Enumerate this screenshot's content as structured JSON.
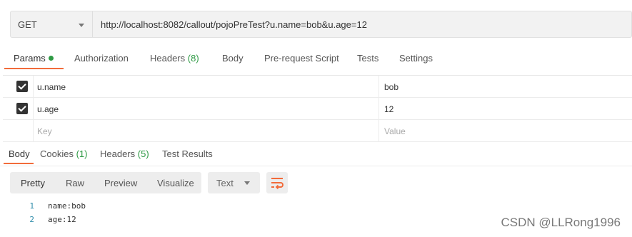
{
  "request": {
    "method": "GET",
    "url": "http://localhost:8082/callout/pojoPreTest?u.name=bob&u.age=12"
  },
  "request_tabs": [
    {
      "label": "Params",
      "count": "",
      "active": true,
      "indicator": "green-dot"
    },
    {
      "label": "Authorization",
      "count": ""
    },
    {
      "label": "Headers",
      "count": "(8)"
    },
    {
      "label": "Body",
      "count": ""
    },
    {
      "label": "Pre-request Script",
      "count": ""
    },
    {
      "label": "Tests",
      "count": ""
    },
    {
      "label": "Settings",
      "count": ""
    }
  ],
  "params": {
    "rows": [
      {
        "checked": true,
        "key": "u.name",
        "value": "bob"
      },
      {
        "checked": true,
        "key": "u.age",
        "value": "12"
      }
    ],
    "key_placeholder": "Key",
    "value_placeholder": "Value"
  },
  "response_tabs": [
    {
      "label": "Body",
      "count": "",
      "active": true
    },
    {
      "label": "Cookies",
      "count": "(1)"
    },
    {
      "label": "Headers",
      "count": "(5)"
    },
    {
      "label": "Test Results",
      "count": ""
    }
  ],
  "response_toolbar": {
    "views": [
      "Pretty",
      "Raw",
      "Preview",
      "Visualize"
    ],
    "format": "Text",
    "wrap_icon": "wrap-lines-icon"
  },
  "response_body": [
    {
      "line": "1",
      "text": "name:bob"
    },
    {
      "line": "2",
      "text": "age:12"
    }
  ],
  "watermark": "CSDN @LLRong1996",
  "colors": {
    "accent": "#f26b3a",
    "green": "#2e9a44",
    "line_number": "#2b8aa8"
  }
}
